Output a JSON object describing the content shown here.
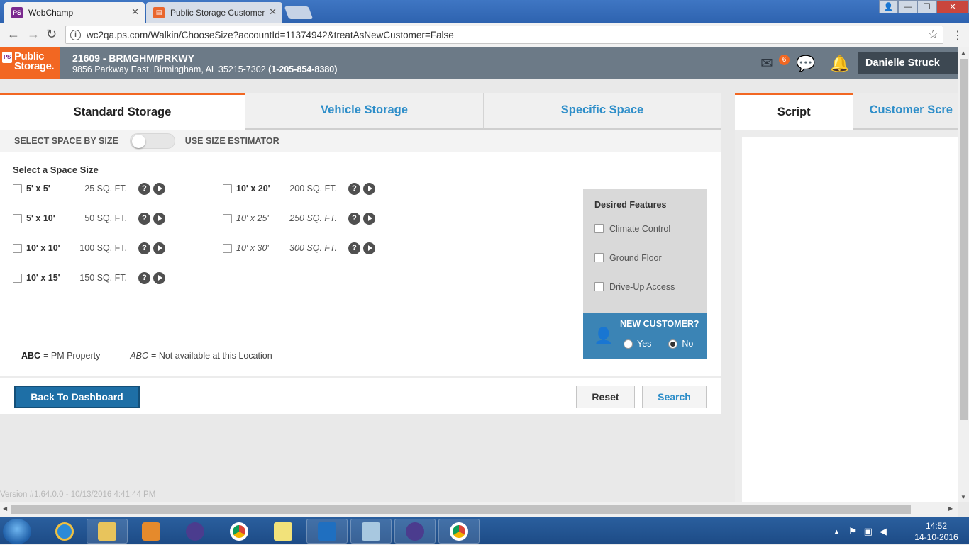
{
  "browser": {
    "tabs": [
      {
        "title": "WebChamp"
      },
      {
        "title": "Public Storage Customer"
      }
    ],
    "url": "wc2qa.ps.com/Walkin/ChooseSize?accountId=11374942&treatAsNewCustomer=False"
  },
  "header": {
    "logo_line1": "Public",
    "logo_line2": "Storage.",
    "store_title": "21609 - BRMGHM/PRKWY",
    "store_address": "9856 Parkway East, Birmingham, AL 35215-7302",
    "store_phone": "(1-205-854-8380)",
    "mail_badge": "6",
    "user_name": "Danielle Struck"
  },
  "tabs": {
    "standard": "Standard Storage",
    "vehicle": "Vehicle Storage",
    "specific": "Specific Space"
  },
  "toggle": {
    "left_label": "SELECT SPACE BY SIZE",
    "right_label": "USE SIZE ESTIMATOR"
  },
  "sizes": {
    "title": "Select a Space Size",
    "left": [
      {
        "label": "5' x 5'",
        "sqft": "25 SQ. FT."
      },
      {
        "label": "5' x 10'",
        "sqft": "50 SQ. FT."
      },
      {
        "label": "10' x 10'",
        "sqft": "100 SQ. FT."
      },
      {
        "label": "10' x 15'",
        "sqft": "150 SQ. FT."
      }
    ],
    "right": [
      {
        "label": "10' x 20'",
        "sqft": "200 SQ. FT.",
        "available": true
      },
      {
        "label": "10' x 25'",
        "sqft": "250 SQ. FT.",
        "available": false
      },
      {
        "label": "10' x 30'",
        "sqft": "300 SQ. FT.",
        "available": false
      }
    ]
  },
  "features": {
    "title": "Desired Features",
    "items": [
      "Climate Control",
      "Ground Floor",
      "Drive-Up Access"
    ]
  },
  "new_customer": {
    "question": "NEW CUSTOMER?",
    "yes": "Yes",
    "no": "No",
    "selected": "No"
  },
  "legend": {
    "abc": "ABC",
    "pm_text": "= PM Property",
    "na_text": "= Not available at this Location"
  },
  "buttons": {
    "back": "Back To Dashboard",
    "reset": "Reset",
    "search": "Search"
  },
  "right_panel": {
    "tab_script": "Script",
    "tab_customer": "Customer Scre"
  },
  "version": "Version #1.64.0.0 - 10/13/2016 4:41:44 PM",
  "clock": {
    "time": "14:52",
    "date": "14-10-2016"
  }
}
